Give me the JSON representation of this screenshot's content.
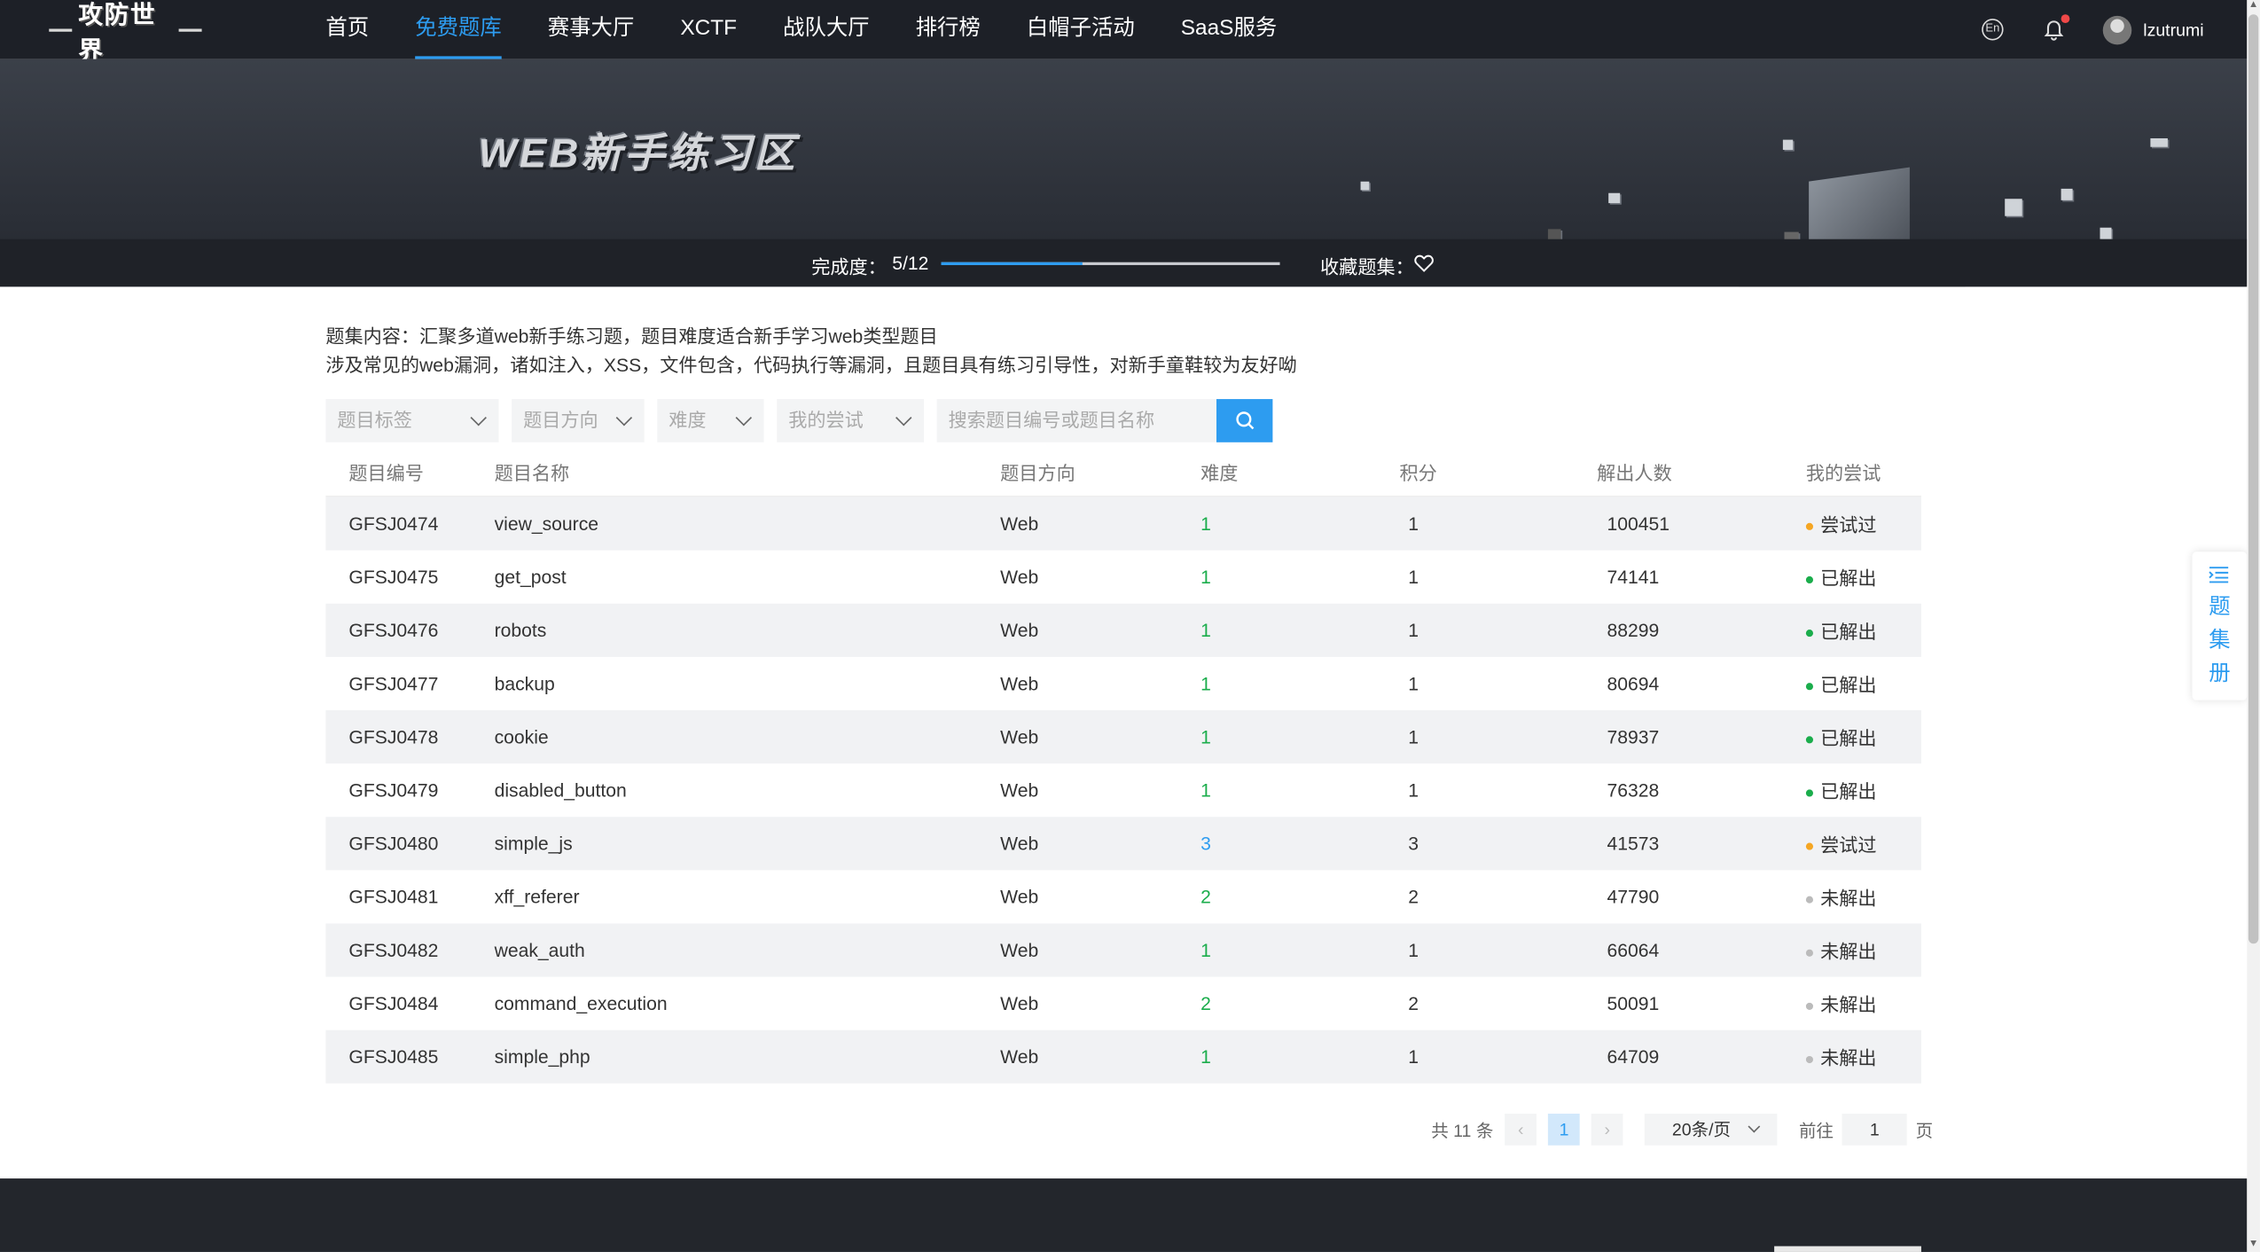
{
  "nav": {
    "logo_text": "攻防世界",
    "items": [
      "首页",
      "免费题库",
      "赛事大厅",
      "XCTF",
      "战队大厅",
      "排行榜",
      "白帽子活动",
      "SaaS服务"
    ],
    "active_index": 1,
    "lang": "En",
    "username": "lzutrumi"
  },
  "banner": {
    "title": "WEB新手练习区",
    "progress_label": "完成度：",
    "progress_value": "5/12",
    "progress_fraction": 0.4167,
    "favorite_label": "收藏题集："
  },
  "description": {
    "line1": "题集内容：汇聚多道web新手练习题，题目难度适合新手学习web类型题目",
    "line2": "涉及常见的web漏洞，诸如注入，XSS，文件包含，代码执行等漏洞，且题目具有练习引导性，对新手童鞋较为友好呦"
  },
  "filters": {
    "tag": "题目标签",
    "direction": "题目方向",
    "difficulty": "难度",
    "my_attempt": "我的尝试",
    "search_placeholder": "搜索题目编号或题目名称"
  },
  "table": {
    "headers": [
      "题目编号",
      "题目名称",
      "题目方向",
      "难度",
      "积分",
      "解出人数",
      "我的尝试"
    ],
    "rows": [
      {
        "id": "GFSJ0474",
        "name": "view_source",
        "dir": "Web",
        "diff": "1",
        "score": "1",
        "solves": "100451",
        "status": "尝试过",
        "status_color": "#f5a623"
      },
      {
        "id": "GFSJ0475",
        "name": "get_post",
        "dir": "Web",
        "diff": "1",
        "score": "1",
        "solves": "74141",
        "status": "已解出",
        "status_color": "#1bad4c"
      },
      {
        "id": "GFSJ0476",
        "name": "robots",
        "dir": "Web",
        "diff": "1",
        "score": "1",
        "solves": "88299",
        "status": "已解出",
        "status_color": "#1bad4c"
      },
      {
        "id": "GFSJ0477",
        "name": "backup",
        "dir": "Web",
        "diff": "1",
        "score": "1",
        "solves": "80694",
        "status": "已解出",
        "status_color": "#1bad4c"
      },
      {
        "id": "GFSJ0478",
        "name": "cookie",
        "dir": "Web",
        "diff": "1",
        "score": "1",
        "solves": "78937",
        "status": "已解出",
        "status_color": "#1bad4c"
      },
      {
        "id": "GFSJ0479",
        "name": "disabled_button",
        "dir": "Web",
        "diff": "1",
        "score": "1",
        "solves": "76328",
        "status": "已解出",
        "status_color": "#1bad4c"
      },
      {
        "id": "GFSJ0480",
        "name": "simple_js",
        "dir": "Web",
        "diff": "3",
        "score": "3",
        "solves": "41573",
        "status": "尝试过",
        "status_color": "#f5a623"
      },
      {
        "id": "GFSJ0481",
        "name": "xff_referer",
        "dir": "Web",
        "diff": "2",
        "score": "2",
        "solves": "47790",
        "status": "未解出",
        "status_color": "#bbbbbb"
      },
      {
        "id": "GFSJ0482",
        "name": "weak_auth",
        "dir": "Web",
        "diff": "1",
        "score": "1",
        "solves": "66064",
        "status": "未解出",
        "status_color": "#bbbbbb"
      },
      {
        "id": "GFSJ0484",
        "name": "command_execution",
        "dir": "Web",
        "diff": "2",
        "score": "2",
        "solves": "50091",
        "status": "未解出",
        "status_color": "#bbbbbb"
      },
      {
        "id": "GFSJ0485",
        "name": "simple_php",
        "dir": "Web",
        "diff": "1",
        "score": "1",
        "solves": "64709",
        "status": "未解出",
        "status_color": "#bbbbbb"
      }
    ]
  },
  "pagination": {
    "total": "共 11 条",
    "prev": "‹",
    "current": "1",
    "next": "›",
    "page_size": "20条/页",
    "goto_label": "前往",
    "goto_value": "1",
    "unit": "页"
  },
  "side_tab": {
    "label": "题集册"
  },
  "colors": {
    "accent": "#2d9cf0",
    "solved": "#1bad4c",
    "attempted": "#f5a623",
    "unsolved": "#bbbbbb"
  }
}
